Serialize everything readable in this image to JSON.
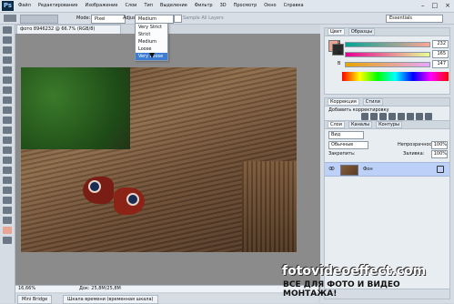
{
  "app": {
    "logo": "Ps"
  },
  "menu": [
    "Файл",
    "Редактирование",
    "Изображение",
    "Слои",
    "Тип",
    "Выделение",
    "Фильтр",
    "3D",
    "Просмотр",
    "Окно",
    "Справка"
  ],
  "window_controls": {
    "minimize": "–",
    "maximize": "□",
    "close": "×"
  },
  "options_bar": {
    "mode_label": "Mode:",
    "mode_value": "Pixel",
    "adjust_label": "Adjustments:",
    "adjust_value": "Medium",
    "checkbox_label": "Sample All Layers",
    "workspace": "Essentials"
  },
  "dropdown": {
    "items": [
      "Very Strict",
      "Strict",
      "Medium",
      "Loose",
      "Very Loose"
    ],
    "selected": "Very Loose"
  },
  "document_tab": "фото 8946232 @ 66.7% (RGB/8)",
  "status": {
    "zoom": "16,66%",
    "doc": "Док: 25,8M/25,8M"
  },
  "bottom_tabs": [
    "Mini Bridge",
    "Шкала времени (временная шкала)"
  ],
  "panels": {
    "color": {
      "tabs": [
        "Цвет",
        "Образцы"
      ],
      "r": "232",
      "g": "165",
      "b": "147",
      "labels": {
        "r": "R",
        "g": "G",
        "b": "B"
      }
    },
    "adjustments": {
      "tabs": [
        "Коррекция",
        "Стили"
      ],
      "title": "Добавить корректировку"
    },
    "layers": {
      "tabs": [
        "Слои",
        "Каналы",
        "Контуры"
      ],
      "kind": "Вид",
      "blend": "Обычные",
      "opacity_label": "Непрозрачность:",
      "opacity": "100%",
      "lock_label": "Закрепить:",
      "fill_label": "Заливка:",
      "fill": "100%",
      "layer_name": "Фон"
    }
  },
  "watermark": {
    "site": "fotovideoeffect.com",
    "tagline": "ВСЕ ДЛЯ ФОТО И ВИДЕО МОНТАЖА!"
  }
}
